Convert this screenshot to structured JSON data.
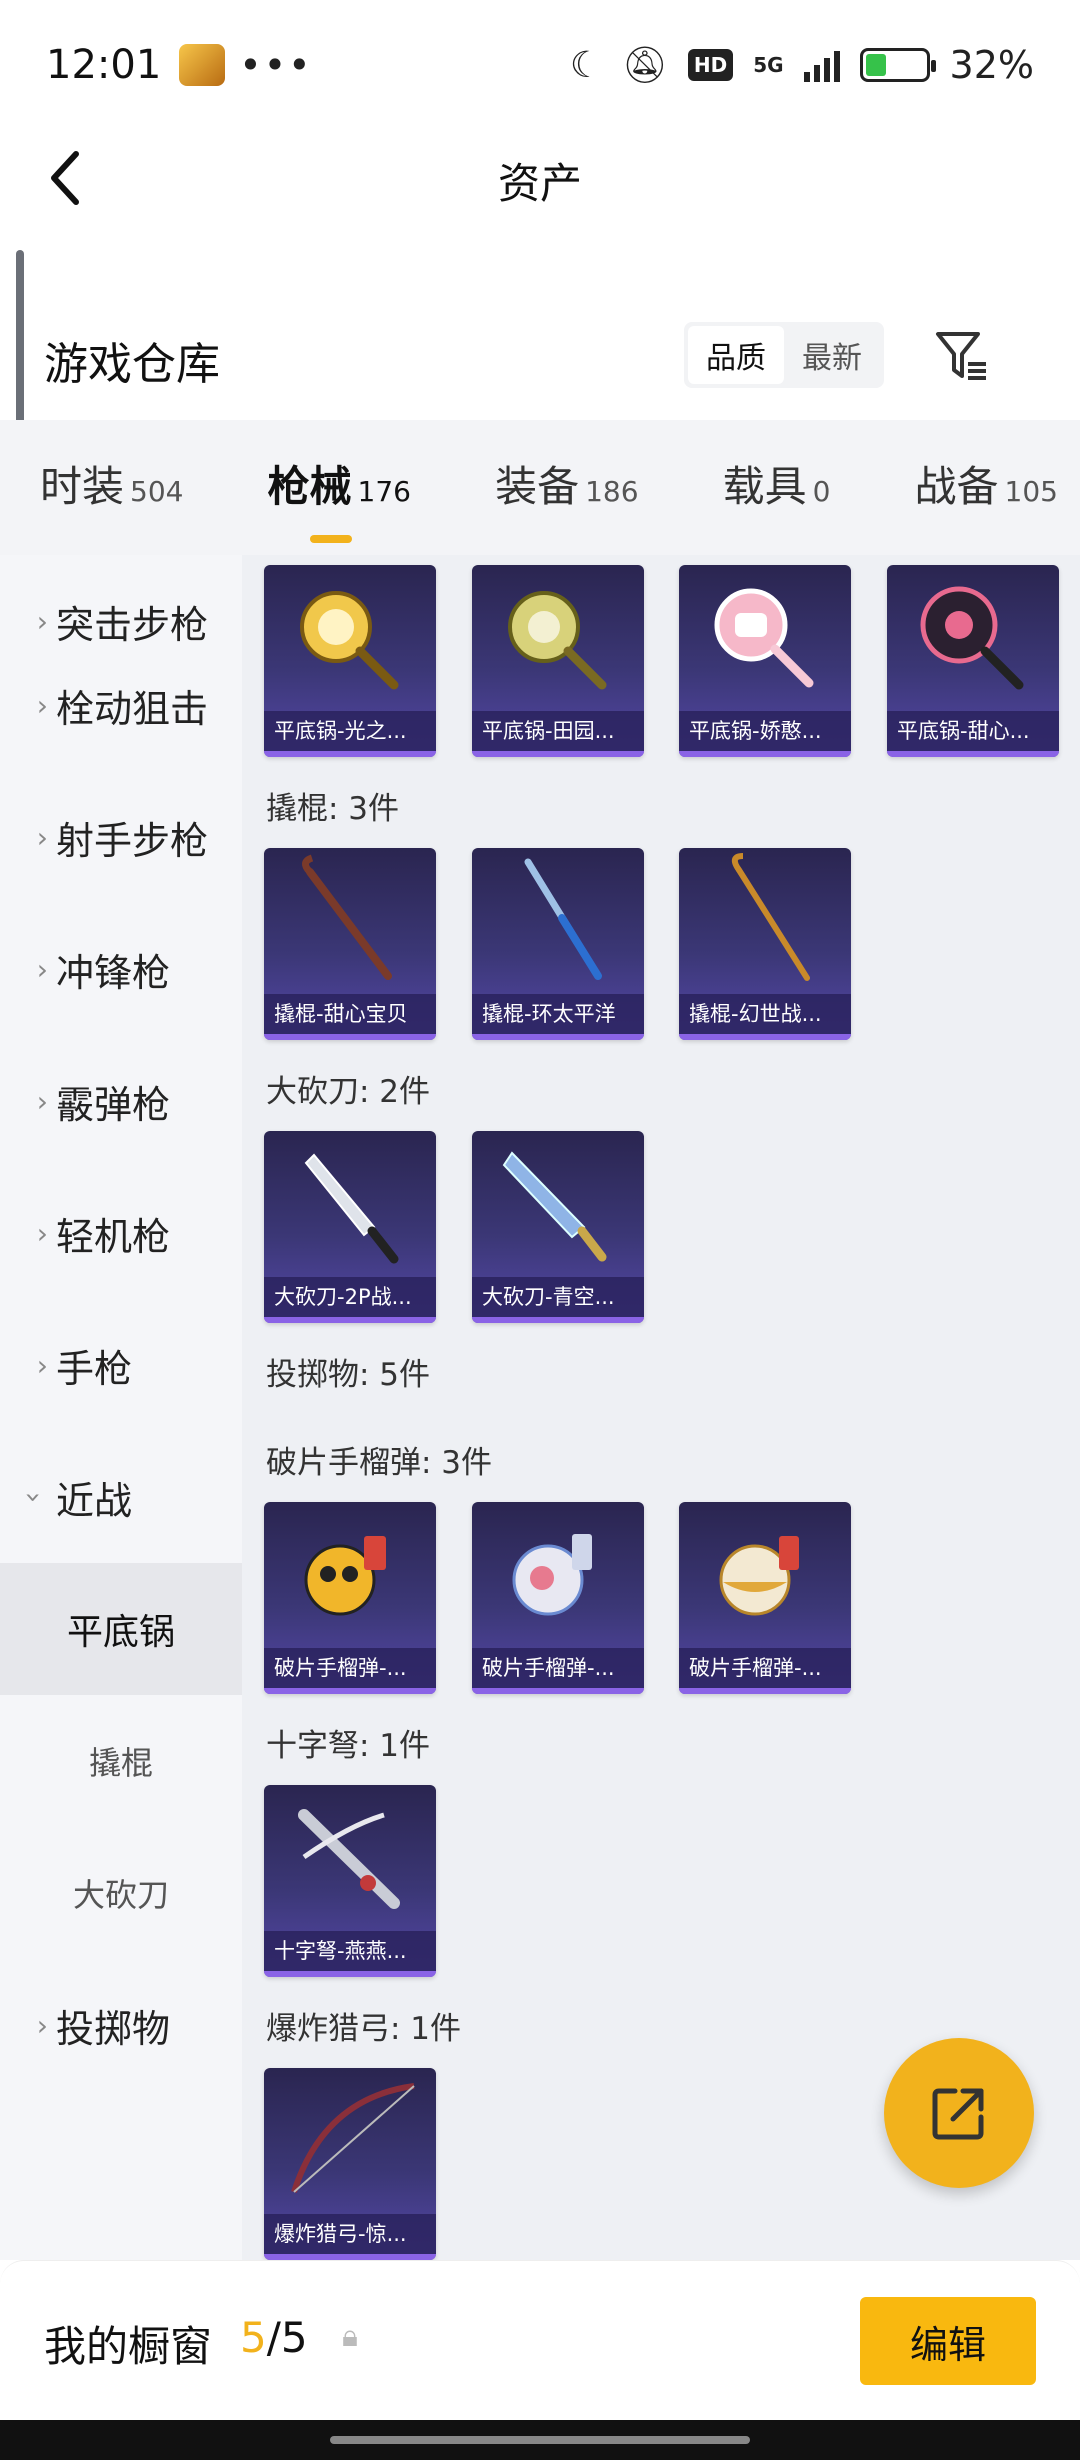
{
  "status": {
    "time": "12:01",
    "more": "•••",
    "network": "5G",
    "hd": "HD",
    "battery": "32%"
  },
  "header": {
    "title": "资产"
  },
  "warehouse": {
    "title": "游戏仓库",
    "sort_options": [
      "品质",
      "最新"
    ],
    "sort_active": "品质"
  },
  "tabs": [
    {
      "name": "时装",
      "count": "504"
    },
    {
      "name": "枪械",
      "count": "176",
      "active": true
    },
    {
      "name": "装备",
      "count": "186"
    },
    {
      "name": "载具",
      "count": "0"
    },
    {
      "name": "战备",
      "count": "105"
    }
  ],
  "sidebar": {
    "items": [
      "突击步枪",
      "栓动狙击",
      "射手步枪",
      "冲锋枪",
      "霰弹枪",
      "轻机枪",
      "手枪",
      "近战",
      "投掷物"
    ],
    "sub_items": [
      "平底锅",
      "撬棍",
      "大砍刀"
    ],
    "active_sub": "平底锅"
  },
  "content": {
    "groups": [
      {
        "label": "",
        "items": [
          "平底锅-光之...",
          "平底锅-田园...",
          "平底锅-娇憨...",
          "平底锅-甜心..."
        ]
      },
      {
        "label": "撬棍: 3件",
        "items": [
          "撬棍-甜心宝贝",
          "撬棍-环太平洋",
          "撬棍-幻世战..."
        ]
      },
      {
        "label": "大砍刀: 2件",
        "items": [
          "大砍刀-2P战...",
          "大砍刀-青空..."
        ]
      },
      {
        "label": "投掷物: 5件",
        "items": []
      },
      {
        "label": "破片手榴弹: 3件",
        "items": [
          "破片手榴弹-...",
          "破片手榴弹-...",
          "破片手榴弹-..."
        ]
      },
      {
        "label": "十字弩: 1件",
        "items": [
          "十字弩-燕燕..."
        ]
      },
      {
        "label": "爆炸猎弓: 1件",
        "items": [
          "爆炸猎弓-惊..."
        ]
      }
    ]
  },
  "bottom": {
    "title": "我的橱窗",
    "current": "5",
    "sep_total": "/5",
    "edit": "编辑"
  },
  "colors": {
    "accent": "#f2b21c",
    "tile_bg": "#3b3776",
    "tile_border": "#8a63e6"
  }
}
